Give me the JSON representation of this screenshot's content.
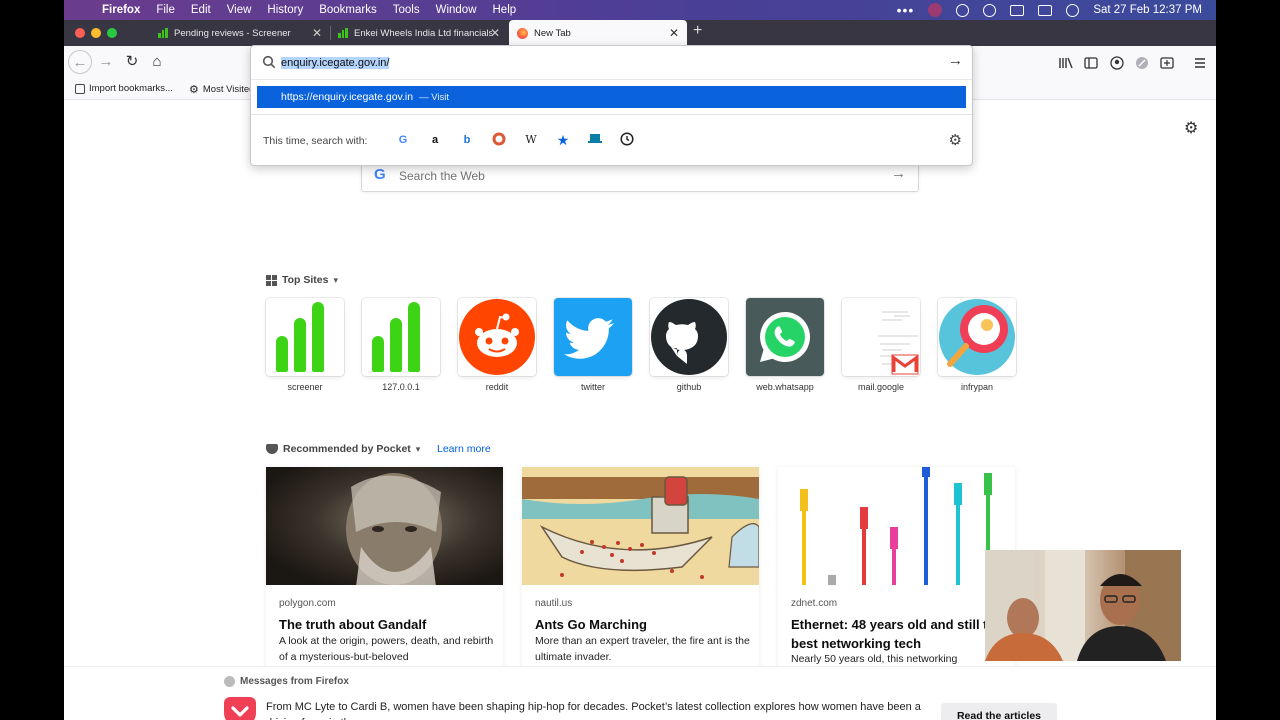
{
  "menubar": {
    "app_name": "Firefox",
    "items": [
      "File",
      "Edit",
      "View",
      "History",
      "Bookmarks",
      "Tools",
      "Window",
      "Help"
    ],
    "datetime": "Sat 27 Feb  12:37 PM"
  },
  "tabs": [
    {
      "title": "Pending reviews - Screener",
      "active": false
    },
    {
      "title": "Enkei Wheels India Ltd financials",
      "active": false
    },
    {
      "title": "New Tab",
      "active": true
    }
  ],
  "url_bar": {
    "value": "enquiry.icegate.gov.in/",
    "suggestion_url": "https://enquiry.icegate.gov.in",
    "suggestion_action": "— Visit",
    "search_with_label": "This time, search with:"
  },
  "bookmarks": [
    {
      "label": "Import bookmarks..."
    },
    {
      "label": "Most Visited"
    }
  ],
  "search": {
    "placeholder": "Search the Web"
  },
  "top_sites": {
    "title": "Top Sites",
    "sites": [
      {
        "label": "screener"
      },
      {
        "label": "127.0.0.1"
      },
      {
        "label": "reddit"
      },
      {
        "label": "twitter"
      },
      {
        "label": "github"
      },
      {
        "label": "web.whatsapp"
      },
      {
        "label": "mail.google"
      },
      {
        "label": "infrypan"
      }
    ]
  },
  "pocket": {
    "title": "Recommended by Pocket",
    "learn_more": "Learn more",
    "cards": [
      {
        "source": "polygon.com",
        "title": "The truth about Gandalf",
        "desc": "A look at the origin, powers, death, and rebirth of a mysterious-but-beloved"
      },
      {
        "source": "nautil.us",
        "title": "Ants Go Marching",
        "desc": "More than an expert traveler, the fire ant is the ultimate invader."
      },
      {
        "source": "zdnet.com",
        "title": "Ethernet: 48 years old and still the best networking tech",
        "desc": "Nearly 50 years old, this networking"
      }
    ]
  },
  "messages": {
    "title": "Messages from Firefox",
    "text": "From MC Lyte to Cardi B, women have been shaping hip-hop for decades. Pocket’s latest collection explores how women have been a driving force in the genre.",
    "button": "Read the articles"
  },
  "colors": {
    "accent": "#0a62dd",
    "tabbar": "#383642",
    "pocket": "#ef4056"
  }
}
